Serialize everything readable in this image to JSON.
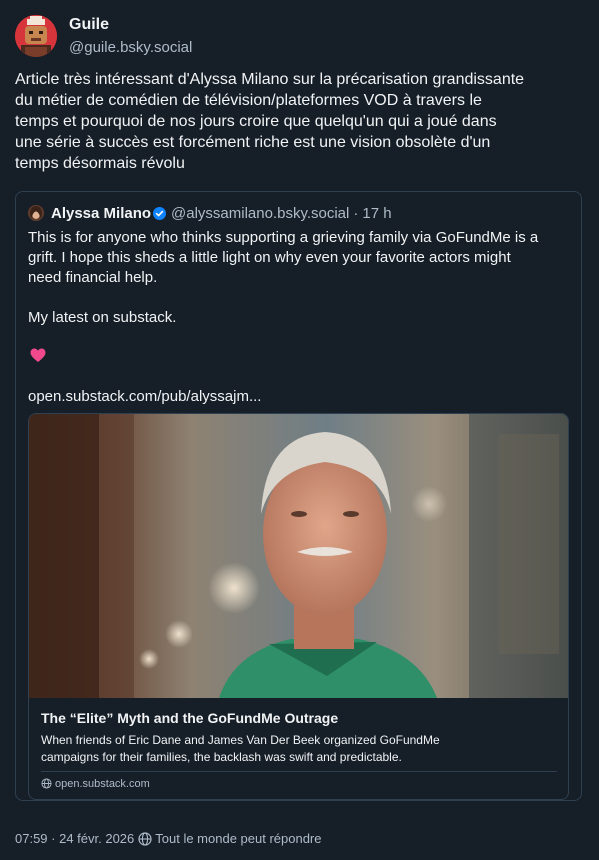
{
  "post": {
    "author": {
      "name": "Guile",
      "handle": "@guile.bsky.social"
    },
    "text_lines": [
      "Article très intéressant d'Alyssa Milano sur la précarisation grandissante",
      "du métier de comédien de télévision/plateformes VOD à travers le",
      "temps et pourquoi de nos jours croire que quelqu'un qui a joué dans",
      "une série à succès est forcément riche est une vision obsolète d'un",
      "temps désormais révolu"
    ],
    "meta": {
      "datetime": "07:59 · 24 févr. 2026",
      "visibility": "Tout le monde peut répondre"
    }
  },
  "quote": {
    "author": {
      "name": "Alyssa Milano",
      "handle": "@alyssamilano.bsky.social",
      "separator": "·",
      "age": "17 h",
      "verified": true
    },
    "text_lines": [
      "This is for anyone who thinks supporting a grieving family via GoFundMe is a",
      "grift. I hope this sheds a little light on why even your favorite actors might",
      "need financial help."
    ],
    "text_line_2": "My latest on substack.",
    "emoji": "heart",
    "link": "open.substack.com/pub/alyssajm...",
    "card": {
      "title": "The “Elite” Myth and the GoFundMe Outrage",
      "description_lines": [
        "When friends of Eric Dane and James Van Der Beek organized GoFundMe",
        "campaigns for their families, the backlash was swift and predictable."
      ],
      "domain": "open.substack.com"
    }
  },
  "colors": {
    "background": "#161e27",
    "text_primary": "#f1f3f5",
    "text_secondary": "#aebbc9",
    "border": "#2e4052",
    "verified_blue": "#1083fe",
    "heart": "#f04a8d"
  },
  "icons": {
    "verified": "verified-check-icon",
    "emoji": "pink-heart-icon",
    "domain": "globe-icon",
    "visibility": "world-icon"
  }
}
